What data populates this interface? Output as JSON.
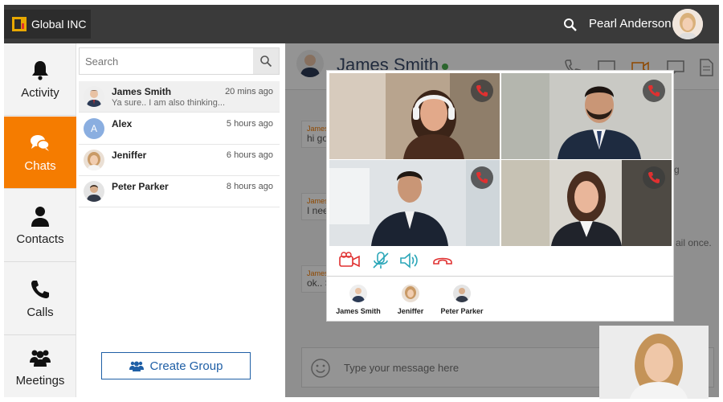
{
  "app": {
    "brand": "Global INC"
  },
  "user": {
    "name": "Pearl Anderson"
  },
  "nav": {
    "items": [
      {
        "label": "Activity",
        "icon": "bell-icon"
      },
      {
        "label": "Chats",
        "icon": "chat-bubbles-icon",
        "active": true
      },
      {
        "label": "Contacts",
        "icon": "person-icon"
      },
      {
        "label": "Calls",
        "icon": "phone-icon"
      },
      {
        "label": "Meetings",
        "icon": "group-icon"
      }
    ]
  },
  "chatlist": {
    "search_placeholder": "Search",
    "contacts": [
      {
        "name": "James Smith",
        "time": "20 mins ago",
        "preview": "Ya sure.. I am also thinking..."
      },
      {
        "name": "Alex",
        "time": "5 hours ago",
        "initial": "A"
      },
      {
        "name": "Jeniffer",
        "time": "6 hours ago"
      },
      {
        "name": "Peter Parker",
        "time": "8 hours ago"
      }
    ],
    "create_group": "Create Group"
  },
  "conversation": {
    "name": "James Smith",
    "messages": [
      {
        "who": "James",
        "text": "hi go"
      },
      {
        "who": "James",
        "text": "I nee"
      },
      {
        "who": "James",
        "text": "ok.. S"
      }
    ],
    "right_fragments": [
      "g",
      "ail once."
    ],
    "composer_placeholder": "Type your message here"
  },
  "call": {
    "participants": [
      {
        "name": "James Smith"
      },
      {
        "name": "Jeniffer"
      },
      {
        "name": "Peter Parker"
      }
    ]
  },
  "colors": {
    "accent": "#f57c00",
    "brand_blue": "#1f5fa6",
    "end_call": "#e03030"
  }
}
